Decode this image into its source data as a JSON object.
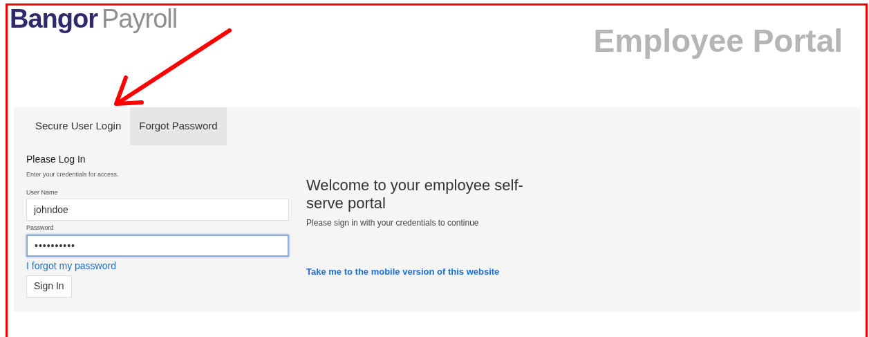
{
  "logo": {
    "brand": "Bangor",
    "product": "Payroll"
  },
  "portal_title": "Employee Portal",
  "tabs": [
    {
      "label": "Secure User Login",
      "selected": true
    },
    {
      "label": "Forgot Password",
      "selected": false
    }
  ],
  "login": {
    "heading": "Please Log In",
    "hint": "Enter your credentials for access.",
    "fields": [
      {
        "label": "User Name",
        "value": "johndoe",
        "kind": "text",
        "focused": false
      },
      {
        "label": "Password",
        "value": "••••••••••",
        "kind": "password",
        "focused": true
      }
    ],
    "forgot_link": "I forgot my password",
    "submit": "Sign In"
  },
  "welcome": {
    "title": "Welcome to your employee self-serve portal",
    "subtitle": "Please sign in with your credentials to continue",
    "mobile_link": "Take me to the mobile version of this website"
  }
}
